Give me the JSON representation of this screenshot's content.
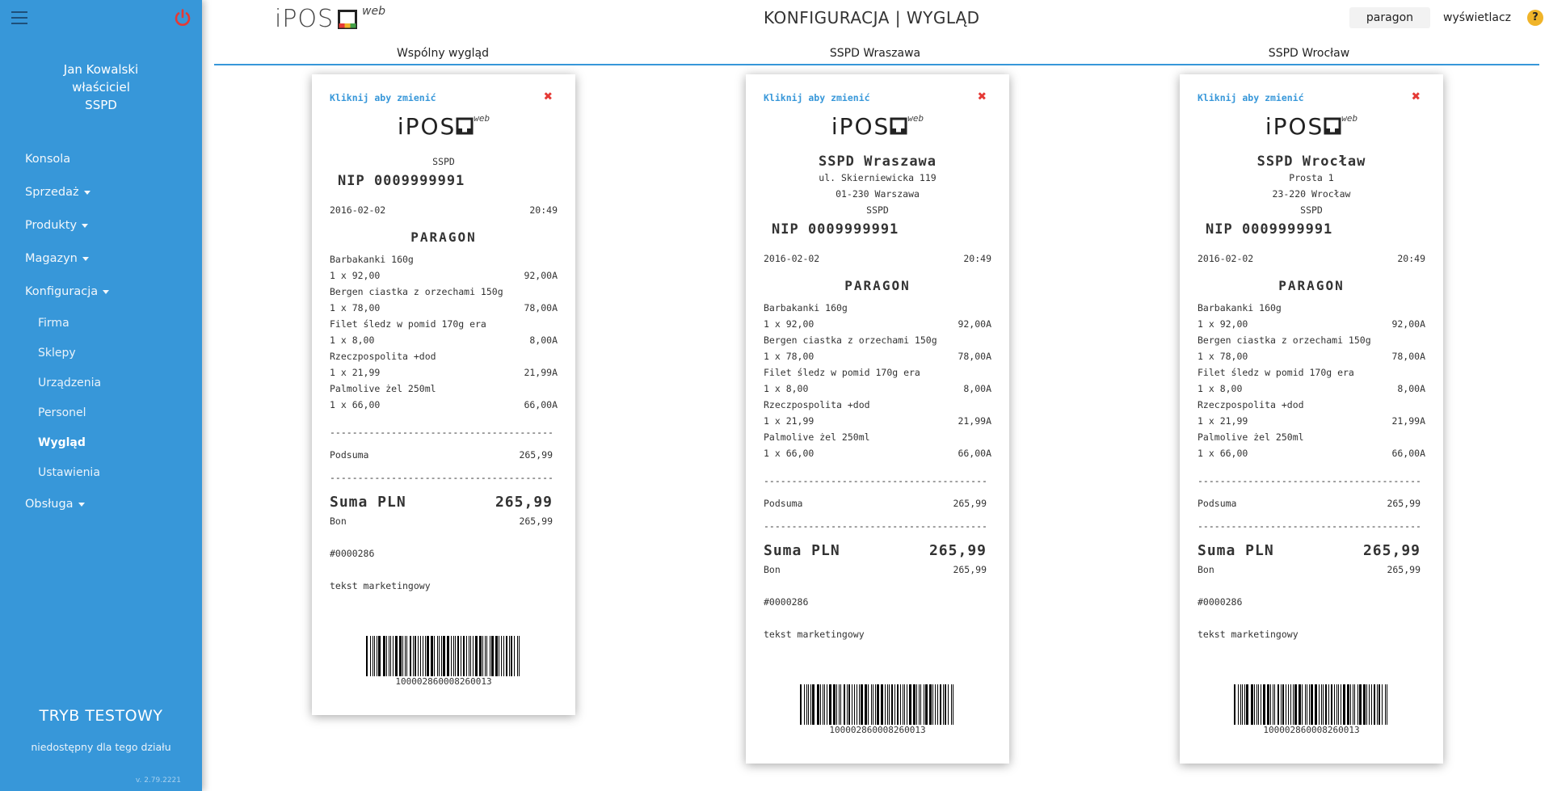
{
  "sidebar": {
    "user_name": "Jan Kowalski",
    "user_role": "właściciel",
    "user_company": "SSPD",
    "nav": [
      {
        "label": "Konsola",
        "caret": false
      },
      {
        "label": "Sprzedaż",
        "caret": true
      },
      {
        "label": "Produkty",
        "caret": true
      },
      {
        "label": "Magazyn",
        "caret": true
      },
      {
        "label": "Konfiguracja",
        "caret": true
      }
    ],
    "subnav": [
      "Firma",
      "Sklepy",
      "Urządzenia",
      "Personel",
      "Wygląd",
      "Ustawienia"
    ],
    "active_subnav": "Wygląd",
    "nav_after": {
      "label": "Obsługa",
      "caret": true
    },
    "test_mode": "TRYB TESTOWY",
    "test_sub": "niedostępny dla tego działu",
    "version": "v. 2.79.2221"
  },
  "header": {
    "logo_text": "iPOS",
    "logo_sup": "web",
    "title": "KONFIGURACJA | WYGLĄD",
    "btn_paragon": "paragon",
    "btn_display": "wyświetlacz",
    "help": "?"
  },
  "tabs": [
    "Wspólny wygląd",
    "SSPD Wraszawa",
    "SSPD Wrocław"
  ],
  "receipts": [
    {
      "change": "Kliknij aby zmienić",
      "close": "✖",
      "logo_text": "iPOS",
      "logo_sup": "web",
      "store_name": "",
      "street": "",
      "city": "",
      "company": "SSPD",
      "nip": "NIP 0009999991",
      "date": "2016-02-02",
      "time": "20:49",
      "doc": "PARAGON",
      "items": [
        {
          "name": "Barbakanki 160g",
          "qty": "1 x 92,00",
          "total": "92,00A"
        },
        {
          "name": "Bergen ciastka z orzechami 150g",
          "qty": "1 x 78,00",
          "total": "78,00A"
        },
        {
          "name": "Filet śledz w pomid 170g era",
          "qty": "1 x 8,00",
          "total": "8,00A"
        },
        {
          "name": "Rzeczpospolita +dod",
          "qty": "1 x 21,99",
          "total": "21,99A"
        },
        {
          "name": "Palmolive żel 250ml",
          "qty": "1 x 66,00",
          "total": "66,00A"
        }
      ],
      "separator": "----------------------------------------",
      "subtotal_label": "Podsuma",
      "subtotal": "265,99",
      "sum_label": "Suma PLN",
      "sum": "265,99",
      "pay_label": "Bon",
      "pay": "265,99",
      "number": "#0000286",
      "marketing": "tekst marketingowy",
      "barcode": "100002860008260013"
    },
    {
      "change": "Kliknij aby zmienić",
      "close": "✖",
      "logo_text": "iPOS",
      "logo_sup": "web",
      "store_name": "SSPD Wraszawa",
      "street": "ul. Skierniewicka 119",
      "city": "01-230 Warszawa",
      "company": "SSPD",
      "nip": "NIP 0009999991",
      "date": "2016-02-02",
      "time": "20:49",
      "doc": "PARAGON",
      "items": [
        {
          "name": "Barbakanki 160g",
          "qty": "1 x 92,00",
          "total": "92,00A"
        },
        {
          "name": "Bergen ciastka z orzechami 150g",
          "qty": "1 x 78,00",
          "total": "78,00A"
        },
        {
          "name": "Filet śledz w pomid 170g era",
          "qty": "1 x 8,00",
          "total": "8,00A"
        },
        {
          "name": "Rzeczpospolita +dod",
          "qty": "1 x 21,99",
          "total": "21,99A"
        },
        {
          "name": "Palmolive żel 250ml",
          "qty": "1 x 66,00",
          "total": "66,00A"
        }
      ],
      "separator": "----------------------------------------",
      "subtotal_label": "Podsuma",
      "subtotal": "265,99",
      "sum_label": "Suma PLN",
      "sum": "265,99",
      "pay_label": "Bon",
      "pay": "265,99",
      "number": "#0000286",
      "marketing": "tekst marketingowy",
      "barcode": "100002860008260013"
    },
    {
      "change": "Kliknij aby zmienić",
      "close": "✖",
      "logo_text": "iPOS",
      "logo_sup": "web",
      "store_name": "SSPD Wrocław",
      "street": "Prosta 1",
      "city": "23-220 Wrocław",
      "company": "SSPD",
      "nip": "NIP 0009999991",
      "date": "2016-02-02",
      "time": "20:49",
      "doc": "PARAGON",
      "items": [
        {
          "name": "Barbakanki 160g",
          "qty": "1 x 92,00",
          "total": "92,00A"
        },
        {
          "name": "Bergen ciastka z orzechami 150g",
          "qty": "1 x 78,00",
          "total": "78,00A"
        },
        {
          "name": "Filet śledz w pomid 170g era",
          "qty": "1 x 8,00",
          "total": "8,00A"
        },
        {
          "name": "Rzeczpospolita +dod",
          "qty": "1 x 21,99",
          "total": "21,99A"
        },
        {
          "name": "Palmolive żel 250ml",
          "qty": "1 x 66,00",
          "total": "66,00A"
        }
      ],
      "separator": "----------------------------------------",
      "subtotal_label": "Podsuma",
      "subtotal": "265,99",
      "sum_label": "Suma PLN",
      "sum": "265,99",
      "pay_label": "Bon",
      "pay": "265,99",
      "number": "#0000286",
      "marketing": "tekst marketingowy",
      "barcode": "100002860008260013"
    }
  ],
  "colors": {
    "sidebar": "#3797d9",
    "accent": "#3797d9",
    "close": "#e53935",
    "power": "#e53935",
    "help": "#f0b429"
  }
}
